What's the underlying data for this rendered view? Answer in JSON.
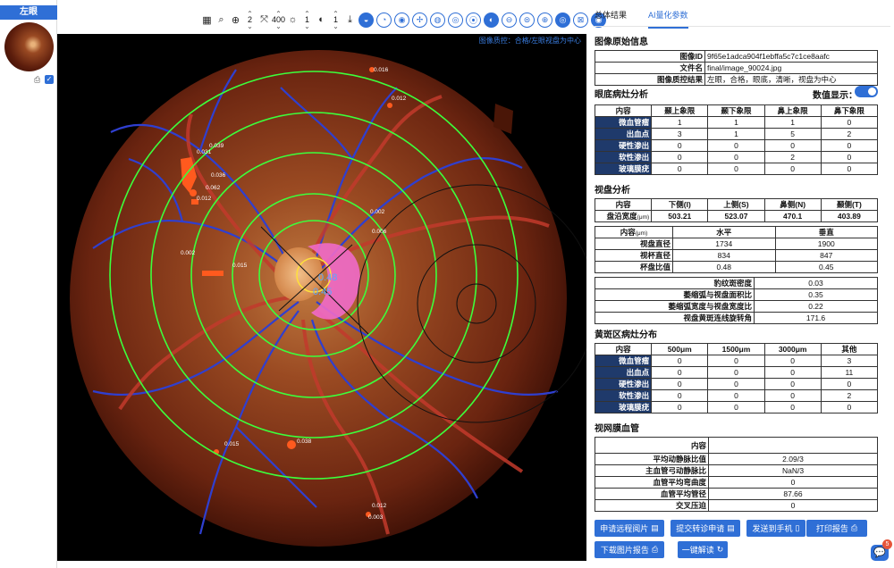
{
  "sidebar": {
    "eye_label": "左眼"
  },
  "toolbar": {
    "zoom_value": "2",
    "size_value": "400",
    "brightness_value": "1",
    "contrast_value": "1"
  },
  "viewer": {
    "qc_note": "图像质控：合格/左眼视盘为中心",
    "overlay_values": [
      "0.016",
      "0.012",
      "0.039",
      "0.031",
      "0.036",
      "0.062",
      "0.012",
      "0.002",
      "0.006",
      "0.002",
      "0.015",
      "0.015",
      "0.038",
      "0.012",
      "0.003"
    ],
    "disc_values": [
      "0.48",
      "0.45"
    ]
  },
  "tabs": {
    "overall": "总体结果",
    "ai": "AI量化参数"
  },
  "image_info": {
    "title": "图像原始信息",
    "rows": [
      {
        "k": "图像ID",
        "v": "9f65e1adca904f1ebffa5c7c1ce8aafc"
      },
      {
        "k": "文件名",
        "v": "final/image_90024.jpg"
      },
      {
        "k": "图像质控结果",
        "v": "左眼，合格，眼底，清晰，视盘为中心"
      }
    ]
  },
  "lesion": {
    "title": "眼底病灶分析",
    "toggle_label": "数值显示：",
    "headers": [
      "内容",
      "颞上象限",
      "颞下象限",
      "鼻上象限",
      "鼻下象限"
    ],
    "rows": [
      {
        "k": "微血管瘤",
        "v": [
          "1",
          "1",
          "1",
          "0"
        ]
      },
      {
        "k": "出血点",
        "v": [
          "3",
          "1",
          "5",
          "2"
        ]
      },
      {
        "k": "硬性渗出",
        "v": [
          "0",
          "0",
          "0",
          "0"
        ]
      },
      {
        "k": "软性渗出",
        "v": [
          "0",
          "0",
          "2",
          "0"
        ]
      },
      {
        "k": "玻璃膜疣",
        "v": [
          "0",
          "0",
          "0",
          "0"
        ]
      }
    ]
  },
  "disc": {
    "title": "视盘分析",
    "rim_headers": [
      "内容",
      "下侧(I)",
      "上侧(S)",
      "鼻侧(N)",
      "颞侧(T)"
    ],
    "rim_label": "盘沿宽度",
    "rim_unit": "(μm)",
    "rim_values": [
      "503.21",
      "523.07",
      "470.1",
      "403.89"
    ],
    "hv_header_label": "内容",
    "hv_header_unit": "(μm)",
    "hv_headers": [
      "水平",
      "垂直"
    ],
    "hv_rows": [
      {
        "k": "视盘直径",
        "h": "1734",
        "v": "1900"
      },
      {
        "k": "视杯直径",
        "h": "834",
        "v": "847"
      },
      {
        "k": "杯盘比值",
        "h": "0.48",
        "v": "0.45"
      }
    ],
    "single_rows": [
      {
        "k": "豹纹斑密度",
        "v": "0.03"
      },
      {
        "k": "萎缩弧与视盘面积比",
        "v": "0.35"
      },
      {
        "k": "萎缩弧宽度与视盘宽度比",
        "v": "0.22"
      },
      {
        "k": "视盘黄斑连线旋转角",
        "v": "171.6"
      }
    ]
  },
  "macula": {
    "title": "黄斑区病灶分布",
    "headers": [
      "内容",
      "500μm",
      "1500μm",
      "3000μm",
      "其他"
    ],
    "rows": [
      {
        "k": "微血管瘤",
        "v": [
          "0",
          "0",
          "0",
          "3"
        ]
      },
      {
        "k": "出血点",
        "v": [
          "0",
          "0",
          "0",
          "11"
        ]
      },
      {
        "k": "硬性渗出",
        "v": [
          "0",
          "0",
          "0",
          "0"
        ]
      },
      {
        "k": "软性渗出",
        "v": [
          "0",
          "0",
          "0",
          "2"
        ]
      },
      {
        "k": "玻璃膜疣",
        "v": [
          "0",
          "0",
          "0",
          "0"
        ]
      }
    ]
  },
  "vessel": {
    "title": "视网膜血管",
    "header": "内容",
    "rows": [
      {
        "k": "平均动静脉比值",
        "v": "2.09/3"
      },
      {
        "k": "主血管弓动静脉比",
        "v": "NaN/3"
      },
      {
        "k": "血管平均弯曲度",
        "v": "0"
      },
      {
        "k": "血管平均管径",
        "v": "87.66"
      },
      {
        "k": "交叉压迫",
        "v": "0"
      }
    ]
  },
  "buttons": {
    "remote_read": "申请远程阅片",
    "referral": "提交转诊申请",
    "send_phone": "发送到手机",
    "print_report": "打印报告",
    "download_report": "下载图片报告",
    "one_click": "一键解读"
  },
  "chat_badge": "5",
  "colors": {
    "accent": "#2f6fd6",
    "table_header": "#1f3a6b",
    "ring": "#3cff3c",
    "lesion": "#ff5a1e"
  }
}
